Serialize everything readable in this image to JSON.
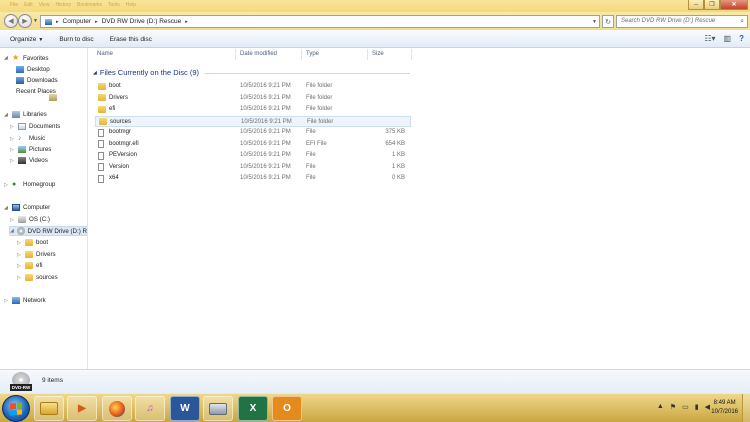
{
  "window": {
    "menu": [
      "File",
      "Edit",
      "View",
      "History",
      "Bookmarks",
      "Tools",
      "Help"
    ],
    "controls": {
      "minimize": "–",
      "restore": "❐",
      "close": "✕"
    }
  },
  "address": {
    "segments": [
      "Computer",
      "DVD RW Drive (D:) Rescue"
    ],
    "separator": "▸",
    "search_placeholder": "Search DVD RW Drive (D:) Rescue"
  },
  "toolbar": {
    "organize": "Organize",
    "burn": "Burn to disc",
    "erase": "Erase this disc"
  },
  "nav": {
    "favorites": "Favorites",
    "desktop": "Desktop",
    "downloads": "Downloads",
    "recent": "Recent Places",
    "libraries": "Libraries",
    "documents": "Documents",
    "music": "Music",
    "pictures": "Pictures",
    "videos": "Videos",
    "homegroup": "Homegroup",
    "computer": "Computer",
    "os": "OS (C:)",
    "dvd": "DVD RW Drive (D:) R",
    "sub": [
      "boot",
      "Drivers",
      "efi",
      "sources"
    ],
    "network": "Network"
  },
  "columns": {
    "name": "Name",
    "date": "Date modified",
    "type": "Type",
    "size": "Size"
  },
  "group_title": "Files Currently on the Disc (9)",
  "files": [
    {
      "name": "boot",
      "date": "10/5/2016 9:21 PM",
      "type": "File folder",
      "size": "",
      "kind": "folder"
    },
    {
      "name": "Drivers",
      "date": "10/5/2016 9:21 PM",
      "type": "File folder",
      "size": "",
      "kind": "folder"
    },
    {
      "name": "efi",
      "date": "10/5/2016 9:21 PM",
      "type": "File folder",
      "size": "",
      "kind": "folder"
    },
    {
      "name": "sources",
      "date": "10/5/2016 9:21 PM",
      "type": "File folder",
      "size": "",
      "kind": "folder"
    },
    {
      "name": "bootmgr",
      "date": "10/5/2016 9:21 PM",
      "type": "File",
      "size": "375 KB",
      "kind": "file"
    },
    {
      "name": "bootmgr.efi",
      "date": "10/5/2016 9:21 PM",
      "type": "EFI File",
      "size": "654 KB",
      "kind": "file"
    },
    {
      "name": "PEVersion",
      "date": "10/5/2016 9:21 PM",
      "type": "File",
      "size": "1 KB",
      "kind": "file"
    },
    {
      "name": "Version",
      "date": "10/5/2016 9:21 PM",
      "type": "File",
      "size": "1 KB",
      "kind": "file"
    },
    {
      "name": "x64",
      "date": "10/5/2016 9:21 PM",
      "type": "File",
      "size": "0 KB",
      "kind": "file"
    }
  ],
  "status": {
    "items": "9 items",
    "dvd_label": "DVD-RW"
  },
  "taskbar": {
    "apps": [
      "explorer",
      "media-player",
      "firefox",
      "itunes",
      "word",
      "network-tool",
      "excel",
      "outlook"
    ],
    "app_glyphs": [
      "",
      "▶",
      "",
      "♫",
      "W",
      "",
      "X",
      "O"
    ],
    "time": "8:49 AM",
    "date": "10/7/2016"
  }
}
